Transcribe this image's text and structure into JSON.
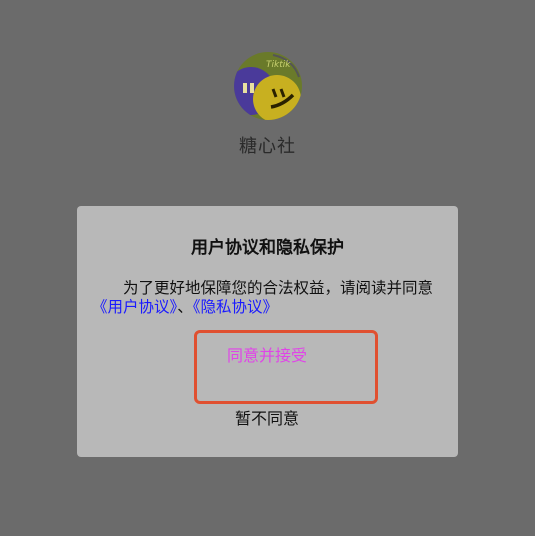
{
  "app": {
    "name": "糖心社",
    "logo_text": "Tiktik",
    "logo_face": "ツ"
  },
  "dialog": {
    "title": "用户协议和隐私保护",
    "message_prefix": "为了更好地保障您的合法权益，请阅读并同意",
    "user_agreement_link": "《用户协议》",
    "separator": "、",
    "privacy_link": "《隐私协议》",
    "accept_label": "同意并接受",
    "decline_label": "暂不同意"
  },
  "colors": {
    "overlay": "#6b6b6b",
    "dialog_bg": "#b8b8b8",
    "link": "#1a1aff",
    "accept": "#e044e8",
    "highlight": "#e05030"
  }
}
